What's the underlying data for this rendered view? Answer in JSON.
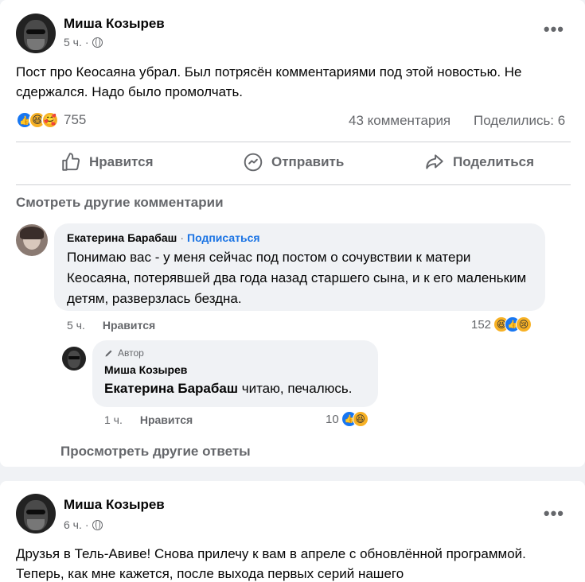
{
  "post1": {
    "author": "Миша Козырев",
    "time": "5 ч.",
    "dot": "·",
    "text": "Пост про Кеосаяна убрал. Был потрясён комментариями под этой новостью. Не сдержался. Надо было промолчать.",
    "reaction_count": "755",
    "comments_count": "43 комментария",
    "shares_count": "Поделились: 6",
    "actions": {
      "like": "Нравится",
      "send": "Отправить",
      "share": "Поделиться"
    },
    "see_more_comments": "Смотреть другие комментарии",
    "comment": {
      "author": "Екатерина Барабаш",
      "dot": "·",
      "follow": "Подписаться",
      "text": "Понимаю вас - у меня сейчас под постом о сочувствии к матери Кеосаяна, потерявшей два года назад старшего сына, и к его маленьким детям, разверзлась бездна.",
      "time": "5 ч.",
      "like": "Нравится",
      "reaction_count": "152"
    },
    "reply": {
      "badge": "Автор",
      "author": "Миша Козырев",
      "mention": "Екатерина Барабаш",
      "text": " читаю, печалюсь.",
      "time": "1 ч.",
      "like": "Нравится",
      "reaction_count": "10"
    },
    "see_more_replies": "Просмотреть другие ответы"
  },
  "post2": {
    "author": "Миша Козырев",
    "time": "6 ч.",
    "dot": "·",
    "text": "Друзья в Тель-Авиве!  Снова прилечу к вам в апреле с обновлённой программой. Теперь, как мне кажется, после выхода первых серий нашего"
  },
  "colors": {
    "accent": "#1b74e4",
    "like_blue": "#1877f2",
    "muted": "#65676b",
    "bg": "#f0f2f5"
  },
  "icons": [
    "thumbs-up-icon",
    "messenger-icon",
    "share-arrow-icon",
    "globe-icon",
    "more-dots-icon",
    "pen-icon",
    "like-reaction-icon",
    "haha-reaction-icon",
    "care-reaction-icon",
    "sad-reaction-icon"
  ]
}
